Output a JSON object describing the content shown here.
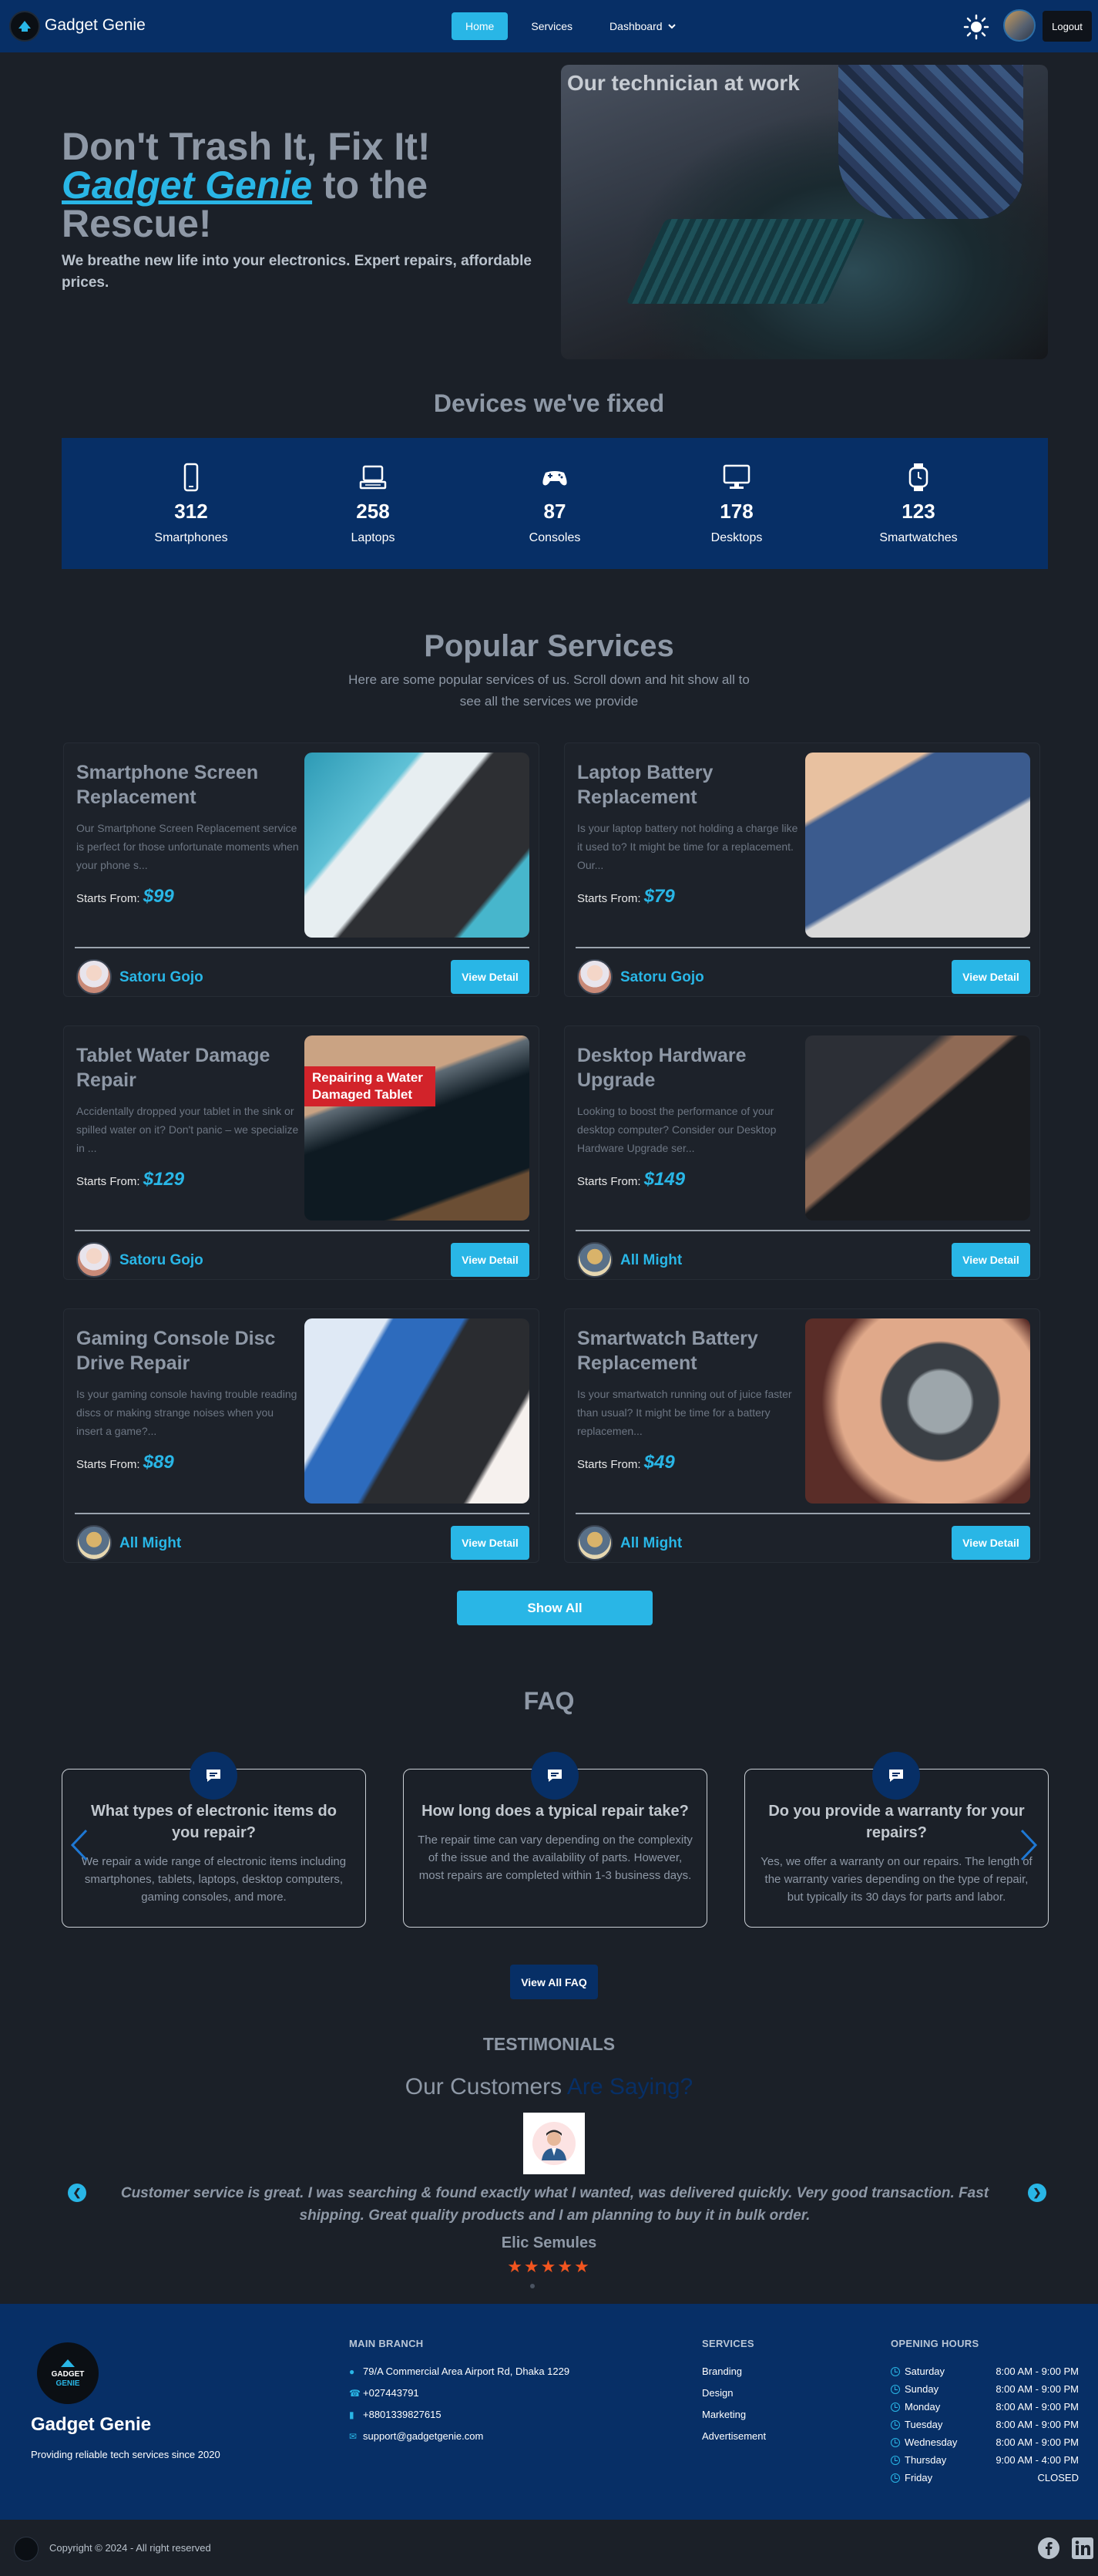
{
  "nav": {
    "brand": "Gadget Genie",
    "links": [
      "Home",
      "Services",
      "Dashboard"
    ],
    "dropdown_caret": "⌄",
    "logout": "Logout",
    "theme_icon": "sun-icon"
  },
  "hero": {
    "title_line1": "Don't Trash It, Fix It!",
    "title_brand": "Gadget Genie",
    "title_rest": " to the Rescue!",
    "subtitle": "We breathe new life into your electronics. Expert repairs, affordable prices.",
    "image_caption": "Our technician at work"
  },
  "devices": {
    "title": "Devices we've fixed",
    "items": [
      {
        "icon": "smartphone-icon",
        "count": "312",
        "label": "Smartphones"
      },
      {
        "icon": "laptop-icon",
        "count": "258",
        "label": "Laptops"
      },
      {
        "icon": "gamepad-icon",
        "count": "87",
        "label": "Consoles"
      },
      {
        "icon": "desktop-icon",
        "count": "178",
        "label": "Desktops"
      },
      {
        "icon": "smartwatch-icon",
        "count": "123",
        "label": "Smartwatches"
      }
    ]
  },
  "services": {
    "title": "Popular Services",
    "subtitle": "Here are some popular services of us. Scroll down and hit show all to see all the services we provide",
    "price_prefix": "Starts From: ",
    "detail_label": "View Detail",
    "show_all": "Show All",
    "cards": [
      {
        "title": "Smartphone Screen Replacement",
        "desc": "Our Smartphone Screen Replacement service is perfect for those unfortunate moments when your phone s...",
        "price": "$99",
        "author": "Satoru Gojo"
      },
      {
        "title": "Laptop Battery Replacement",
        "desc": "Is your laptop battery not holding a charge like it used to? It might be time for a replacement. Our...",
        "price": "$79",
        "author": "Satoru Gojo"
      },
      {
        "title": "Tablet Water Damage Repair",
        "desc": "Accidentally dropped your tablet in the sink or spilled water on it? Don't panic – we specialize in ...",
        "price": "$129",
        "author": "Satoru Gojo",
        "image_tag": "Repairing a Water Damaged Tablet"
      },
      {
        "title": "Desktop Hardware Upgrade",
        "desc": "Looking to boost the performance of your desktop computer? Consider our Desktop Hardware Upgrade ser...",
        "price": "$149",
        "author": "All Might"
      },
      {
        "title": "Gaming Console Disc Drive Repair",
        "desc": "Is your gaming console having trouble reading discs or making strange noises when you insert a game?...",
        "price": "$89",
        "author": "All Might"
      },
      {
        "title": "Smartwatch Battery Replacement",
        "desc": "Is your smartwatch running out of juice faster than usual? It might be time for a battery replacemen...",
        "price": "$49",
        "author": "All Might"
      }
    ]
  },
  "faq": {
    "title": "FAQ",
    "items": [
      {
        "q": "What types of electronic items do you repair?",
        "a": "We repair a wide range of electronic items including smartphones, tablets, laptops, desktop computers, gaming consoles, and more."
      },
      {
        "q": "How long does a typical repair take?",
        "a": "The repair time can vary depending on the complexity of the issue and the availability of parts. However, most repairs are completed within 1-3 business days."
      },
      {
        "q": "Do you provide a warranty for your repairs?",
        "a": "Yes, we offer a warranty on our repairs. The length of the warranty varies depending on the type of repair, but typically its 30 days for parts and labor."
      }
    ],
    "view_all": "View All FAQ"
  },
  "testimonials": {
    "heading": "TESTIMONIALS",
    "title_plain": "Our Customers ",
    "title_accent": "Are Saying?",
    "quote": "Customer service is great. I was searching & found exactly what I wanted, was delivered quickly. Very good transaction. Fast shipping. Great quality products and I am planning to buy it in bulk order.",
    "name": "Elic Semules",
    "stars": "★★★★★",
    "prev": "❮",
    "next": "❯"
  },
  "footer": {
    "logo_text": [
      "GADGET",
      "GENIE"
    ],
    "brand": "Gadget Genie",
    "tagline": "Providing reliable tech services since 2020",
    "branch_head": "MAIN BRANCH",
    "address": "79/A Commercial Area Airport Rd, Dhaka 1229",
    "phone1": "+027443791",
    "phone2": "+8801339827615",
    "email": "support@gadgetgenie.com",
    "services_head": "SERVICES",
    "services": [
      "Branding",
      "Design",
      "Marketing",
      "Advertisement"
    ],
    "hours_head": "OPENING HOURS",
    "hours": [
      {
        "day": "Saturday",
        "time": "8:00 AM - 9:00 PM"
      },
      {
        "day": "Sunday",
        "time": "8:00 AM - 9:00 PM"
      },
      {
        "day": "Monday",
        "time": "8:00 AM - 9:00 PM"
      },
      {
        "day": "Tuesday",
        "time": "8:00 AM - 9:00 PM"
      },
      {
        "day": "Wednesday",
        "time": "8:00 AM - 9:00 PM"
      },
      {
        "day": "Thursday",
        "time": "9:00 AM - 4:00 PM"
      },
      {
        "day": "Friday",
        "time": "CLOSED"
      }
    ],
    "copyright": "Copyright © 2024 - All right reserved"
  },
  "colors": {
    "accent": "#29b6e6",
    "navy": "#072f66",
    "background": "#1b2028",
    "star": "#f2551f"
  }
}
